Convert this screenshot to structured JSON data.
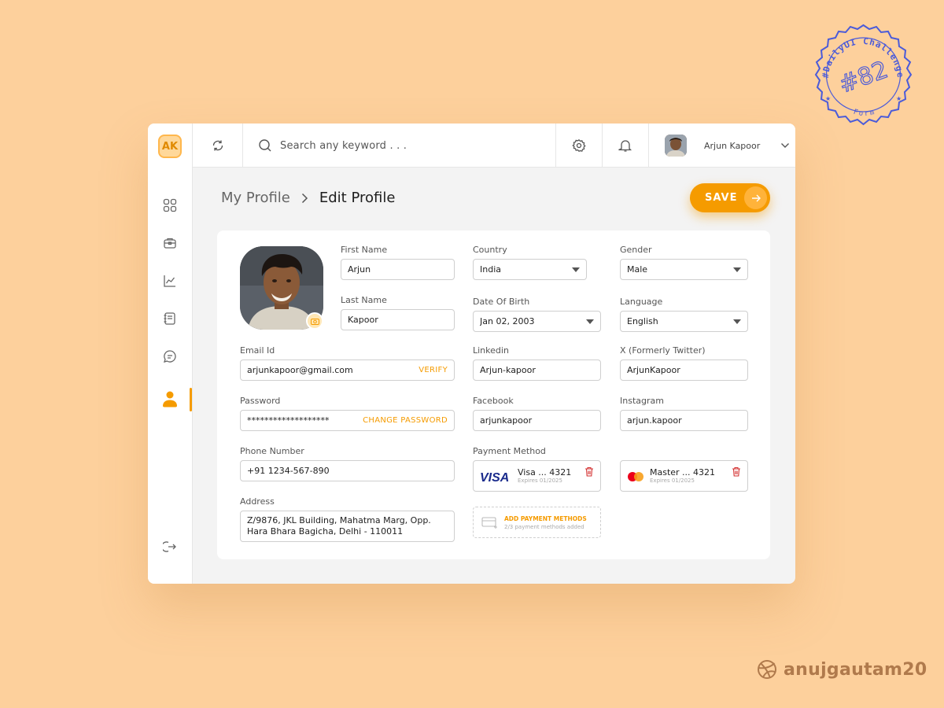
{
  "app": {
    "logo": "AK",
    "accent": "#F59B00",
    "background": "#FDD09C"
  },
  "sidebar": {
    "items": [
      {
        "icon": "grid-icon"
      },
      {
        "icon": "briefcase-icon"
      },
      {
        "icon": "chart-icon"
      },
      {
        "icon": "notebook-icon"
      },
      {
        "icon": "chat-icon"
      },
      {
        "icon": "user-icon",
        "active": true
      }
    ],
    "logout_icon": "logout-icon"
  },
  "topbar": {
    "search_placeholder": "Search any keyword . . .",
    "user_name": "Arjun Kapoor"
  },
  "breadcrumb": {
    "parent": "My Profile",
    "current": "Edit Profile"
  },
  "save_label": "SAVE",
  "form": {
    "first_name": {
      "label": "First Name",
      "value": "Arjun"
    },
    "last_name": {
      "label": "Last Name",
      "value": "Kapoor"
    },
    "country": {
      "label": "Country",
      "value": "India"
    },
    "dob": {
      "label": "Date Of Birth",
      "value": "Jan 02, 2003"
    },
    "gender": {
      "label": "Gender",
      "value": "Male"
    },
    "language": {
      "label": "Language",
      "value": "English"
    },
    "email": {
      "label": "Email Id",
      "value": "arjunkapoor@gmail.com",
      "action": "VERIFY"
    },
    "password": {
      "label": "Password",
      "value": "*******************",
      "action": "CHANGE PASSWORD"
    },
    "phone": {
      "label": "Phone Number",
      "value": "+91 1234-567-890"
    },
    "address": {
      "label": "Address",
      "value": "Z/9876, JKL Building, Mahatma Marg, Opp. Hara Bhara Bagicha, Delhi - 110011"
    },
    "linkedin": {
      "label": "Linkedin",
      "value": "Arjun-kapoor"
    },
    "facebook": {
      "label": "Facebook",
      "value": "arjunkapoor"
    },
    "twitter": {
      "label": "X (Formerly Twitter)",
      "value": "ArjunKapoor"
    },
    "instagram": {
      "label": "Instagram",
      "value": "arjun.kapoor"
    },
    "payment": {
      "label": "Payment Method",
      "cards": [
        {
          "brand": "VISA",
          "name": "Visa ... 4321",
          "expires": "Expires 01/2025"
        },
        {
          "brand": "mastercard",
          "name": "Master ... 4321",
          "expires": "Expires 01/2025"
        }
      ],
      "add_title": "ADD PAYMENT METHODS",
      "add_sub": "2/3 payment methods added"
    }
  },
  "stamp": {
    "top_text": "#DailyUI Challenge",
    "number": "#82",
    "bottom_text": "Form"
  },
  "watermark": "anujgautam20"
}
